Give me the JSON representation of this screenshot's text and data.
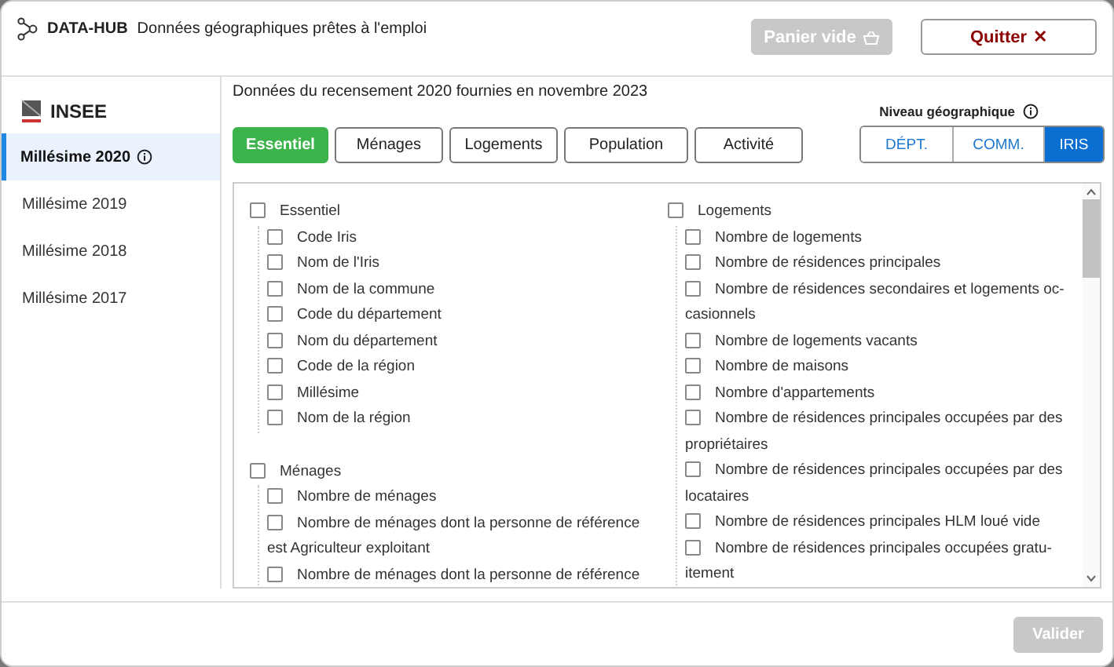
{
  "header": {
    "brand": "DATA-HUB",
    "subtitle": "Données géographiques prêtes à l'emploi",
    "buttons": [
      {
        "kind": "basket",
        "label": "Panier vide",
        "disabled": true
      },
      {
        "kind": "quit",
        "label": "Quitter",
        "glyph": "✕",
        "disabled": false
      }
    ]
  },
  "sidebar": {
    "provider": "INSEE",
    "items": [
      {
        "label": "Millésime 2020",
        "selected": true
      },
      {
        "label": "Millésime 2019",
        "selected": false
      },
      {
        "label": "Millésime 2018",
        "selected": false
      },
      {
        "label": "Millésime 2017",
        "selected": false
      }
    ]
  },
  "description": "Données du recensement 2020 fournies en novembre 2023",
  "tabs": [
    {
      "label": "Essentiel",
      "selected": true
    },
    {
      "label": "Ménages",
      "selected": false
    },
    {
      "label": "Logements",
      "selected": false
    },
    {
      "label": "Population",
      "selected": false
    },
    {
      "label": "Activité",
      "selected": false
    }
  ],
  "geo_level": {
    "label": "Niveau géographique",
    "options": [
      {
        "label": "DÉPT.",
        "selected": false
      },
      {
        "label": "COMM.",
        "selected": false
      },
      {
        "label": "IRIS",
        "selected": true
      }
    ]
  },
  "columns": [
    [
      {
        "label": "Essentiel",
        "checked": false,
        "children": [
          {
            "label": "Code Iris",
            "checked": false
          },
          {
            "label": "Nom de l'Iris",
            "checked": false
          },
          {
            "label": "Nom de la commune",
            "checked": false
          },
          {
            "label": "Code du département",
            "checked": false
          },
          {
            "label": "Nom du département",
            "checked": false
          },
          {
            "label": "Code de la région",
            "checked": false
          },
          {
            "label": "Millésime",
            "checked": false
          },
          {
            "label": "Nom de la région",
            "checked": false
          }
        ]
      },
      {
        "label": "Ménages",
        "checked": false,
        "children": [
          {
            "label": "Nombre de ménages",
            "checked": false
          },
          {
            "label": "Nombre de ménages dont la personne de référence est Agriculteur exploitant",
            "checked": false
          },
          {
            "label": "Nombre de ménages dont la personne de référence",
            "checked": false
          }
        ]
      }
    ],
    [
      {
        "label": "Logements",
        "checked": false,
        "children": [
          {
            "label": "Nombre de logements",
            "checked": false
          },
          {
            "label": "Nombre de résidences principales",
            "checked": false
          },
          {
            "label": "Nombre de résidences secondaires et logements oc-casionnels",
            "checked": false
          },
          {
            "label": "Nombre de logements vacants",
            "checked": false
          },
          {
            "label": "Nombre de maisons",
            "checked": false
          },
          {
            "label": "Nombre d'appartements",
            "checked": false
          },
          {
            "label": "Nombre de résidences principales occupées par des propriétaires",
            "checked": false
          },
          {
            "label": "Nombre de résidences principales occupées par des locataires",
            "checked": false
          },
          {
            "label": "Nombre de résidences principales HLM loué vide",
            "checked": false
          },
          {
            "label": "Nombre de résidences principales occupées gratu-itement",
            "checked": false
          }
        ]
      }
    ]
  ],
  "footer": {
    "button": {
      "label": "Valider",
      "disabled": true
    }
  }
}
